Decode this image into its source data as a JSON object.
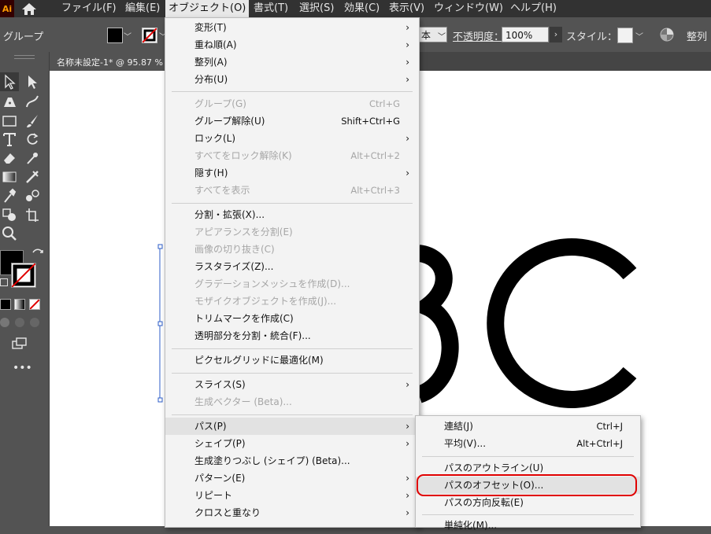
{
  "app": {
    "logo": "Ai"
  },
  "menubar": {
    "items": [
      {
        "label": "ファイル(F)"
      },
      {
        "label": "編集(E)"
      },
      {
        "label": "オブジェクト(O)"
      },
      {
        "label": "書式(T)"
      },
      {
        "label": "選択(S)"
      },
      {
        "label": "効果(C)"
      },
      {
        "label": "表示(V)"
      },
      {
        "label": "ウィンドウ(W)"
      },
      {
        "label": "ヘルプ(H)"
      }
    ]
  },
  "controlbar": {
    "selection_label": "グループ",
    "style_partial": "本",
    "opacity_label": "不透明度：",
    "opacity_value": "100%",
    "style_label": "スタイル：",
    "align_label": "整列"
  },
  "document": {
    "tab_title": "名称未設定-1* @ 95.87 %"
  },
  "canvas": {
    "glyphs": [
      "B",
      "C"
    ]
  },
  "object_menu": {
    "items": [
      {
        "label": "変形(T)",
        "submenu": true
      },
      {
        "label": "重ね順(A)",
        "submenu": true
      },
      {
        "label": "整列(A)",
        "submenu": true
      },
      {
        "label": "分布(U)",
        "submenu": true
      },
      {
        "label": "グループ(G)",
        "shortcut": "Ctrl+G",
        "disabled": true
      },
      {
        "label": "グループ解除(U)",
        "shortcut": "Shift+Ctrl+G"
      },
      {
        "label": "ロック(L)",
        "submenu": true
      },
      {
        "label": "すべてをロック解除(K)",
        "shortcut": "Alt+Ctrl+2",
        "disabled": true
      },
      {
        "label": "隠す(H)",
        "submenu": true
      },
      {
        "label": "すべてを表示",
        "shortcut": "Alt+Ctrl+3",
        "disabled": true
      },
      {
        "label": "分割・拡張(X)..."
      },
      {
        "label": "アピアランスを分割(E)",
        "disabled": true
      },
      {
        "label": "画像の切り抜き(C)",
        "disabled": true
      },
      {
        "label": "ラスタライズ(Z)..."
      },
      {
        "label": "グラデーションメッシュを作成(D)...",
        "disabled": true
      },
      {
        "label": "モザイクオブジェクトを作成(J)...",
        "disabled": true
      },
      {
        "label": "トリムマークを作成(C)"
      },
      {
        "label": "透明部分を分割・統合(F)..."
      },
      {
        "label": "ピクセルグリッドに最適化(M)"
      },
      {
        "label": "スライス(S)",
        "submenu": true
      },
      {
        "label": "生成ベクター (Beta)...",
        "disabled": true
      },
      {
        "label": "パス(P)",
        "submenu": true,
        "highlighted": true
      },
      {
        "label": "シェイプ(P)",
        "submenu": true
      },
      {
        "label": "生成塗りつぶし (シェイプ) (Beta)..."
      },
      {
        "label": "パターン(E)",
        "submenu": true
      },
      {
        "label": "リピート",
        "submenu": true
      },
      {
        "label": "クロスと重なり",
        "submenu": true
      }
    ]
  },
  "path_submenu": {
    "items": [
      {
        "label": "連結(J)",
        "shortcut": "Ctrl+J"
      },
      {
        "label": "平均(V)...",
        "shortcut": "Alt+Ctrl+J"
      },
      {
        "label": "パスのアウトライン(U)"
      },
      {
        "label": "パスのオフセット(O)...",
        "highlighted": true
      },
      {
        "label": "パスの方向反転(E)"
      },
      {
        "label": "単純化(M)..."
      }
    ]
  },
  "colors": {
    "menubar_bg": "#323232",
    "panel_bg": "#535353",
    "menu_bg": "#f3f3f3",
    "highlight_ring": "#e00000",
    "logo": "#ff9a00"
  }
}
